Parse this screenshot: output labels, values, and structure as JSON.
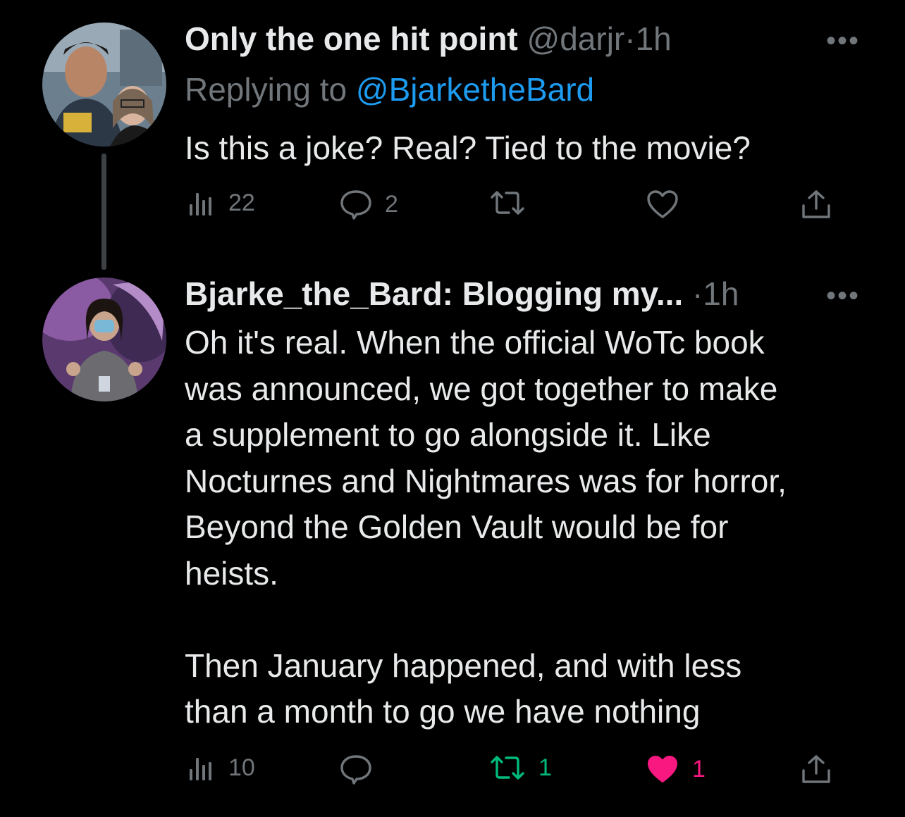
{
  "tweets": [
    {
      "display_name": "Only the one hit point",
      "handle": "@darjr",
      "separator": "·",
      "time": "1h",
      "replying_prefix": "Replying to",
      "replying_to": "@BjarketheBard",
      "text": "Is this a joke? Real? Tied to the movie?",
      "more": "•••",
      "stats": {
        "views": "22",
        "replies": "2",
        "retweets": "",
        "likes": ""
      }
    },
    {
      "display_name": "Bjarke_the_Bard: Blogging my...",
      "separator": "·",
      "time": "1h",
      "text": "Oh it's real. When the official WoTc book\nwas announced, we got together to make\na supplement to go alongside it. Like\nNocturnes and Nightmares was for horror,\nBeyond the Golden Vault would be for\nheists.\n\nThen January happened, and with less\nthan a month to go we have nothing",
      "more": "•••",
      "stats": {
        "views": "10",
        "replies": "",
        "retweets": "1",
        "likes": "1"
      }
    }
  ],
  "colors": {
    "background": "#000000",
    "text": "#e7e9ea",
    "muted": "#71767b",
    "link": "#1d9bf0",
    "retweet_active": "#00ba7c",
    "like_active": "#f91880"
  },
  "icons": [
    "views-icon",
    "reply-icon",
    "retweet-icon",
    "like-icon",
    "share-icon",
    "more-icon"
  ]
}
